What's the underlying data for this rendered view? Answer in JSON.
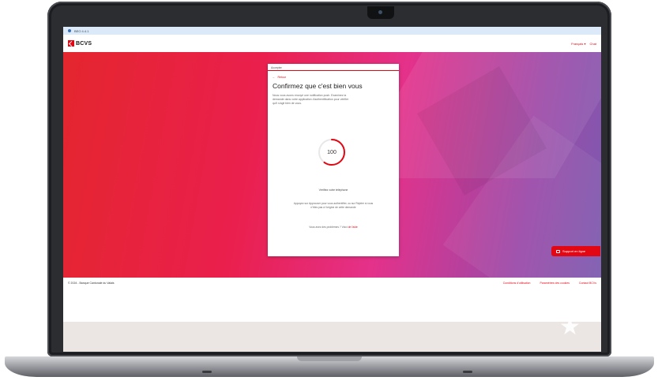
{
  "browser": {
    "url": "BEO 4.4.1"
  },
  "header": {
    "logo_text": "BCVS",
    "language": "Français ▾",
    "chat": "Chat"
  },
  "card": {
    "topbar": "Accepter",
    "back": "Retour",
    "title": "Confirmez que c'est bien vous",
    "description": "Nous vous avons envoyé une notification push. Examinez la demande dans votre application d'authentification pour vérifier qu'il s'agit bien de vous.",
    "timer_value": "100",
    "timer_progress": 0.6,
    "verify": "Vérifiez votre téléphone",
    "hint": "Appuyez sur Approuver pour vous authentifier, ou sur Rejeter si vous n'êtes pas à l'origine de cette demande",
    "problem_prefix": "Vous avez des problèmes ? Voici",
    "help_link": "de l'aide"
  },
  "support": {
    "label": "Support en ligne"
  },
  "footer": {
    "copyright": "© 2024 - Banque Cantonale du Valais",
    "links": [
      "Conditions d'utilisation",
      "Paramètres des cookies",
      "Contact BCVs"
    ]
  },
  "colors": {
    "brand_red": "#e30613",
    "gradient_start": "#e4262e",
    "gradient_end": "#7c5bb0"
  },
  "icons": [
    "lock-icon",
    "logo-icon",
    "back-arrow-icon",
    "chat-icon",
    "star-icon"
  ]
}
